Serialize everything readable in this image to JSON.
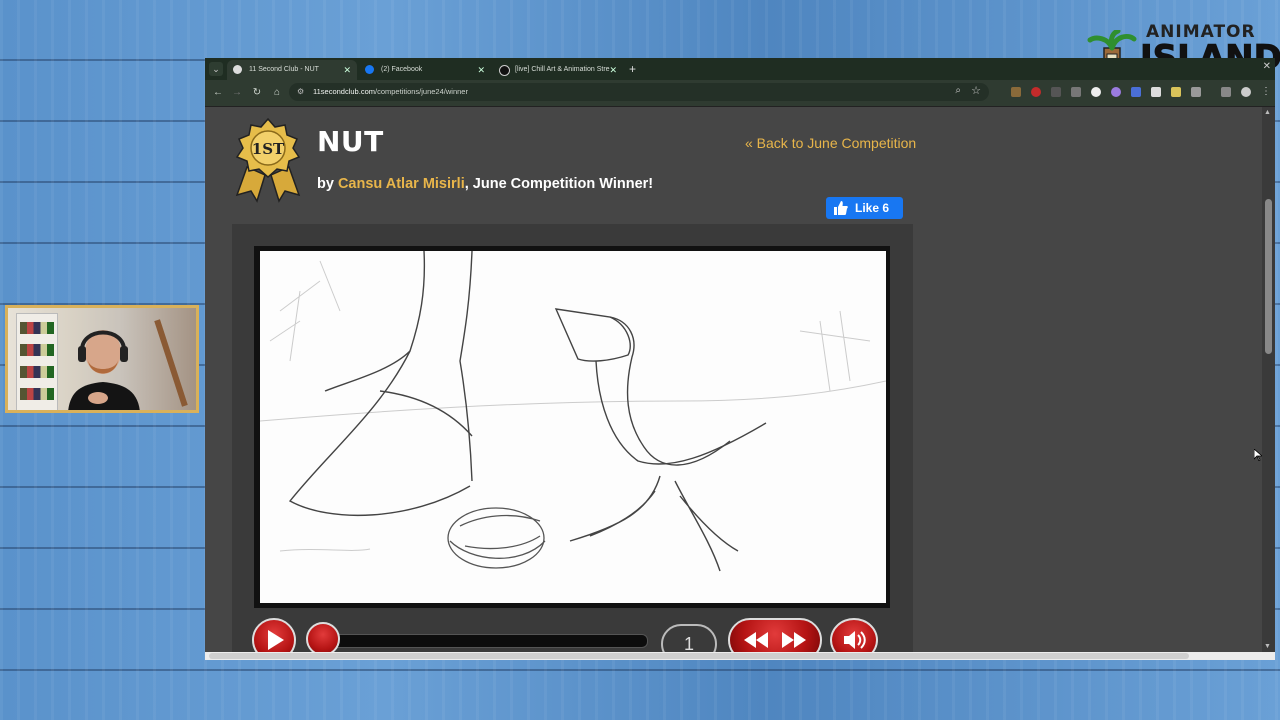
{
  "logo": {
    "line1": "ANIMATOR",
    "line2": "ISLAND"
  },
  "browser": {
    "tabs": [
      {
        "title": "11 Second Club - NUT",
        "active": true
      },
      {
        "title": "(2) Facebook",
        "active": false
      },
      {
        "title": "[live] Chill Art & Animation Stre",
        "active": false
      }
    ],
    "address": {
      "domain": "11secondclub.com",
      "path": "/competitions/june24/winner"
    },
    "colors": {
      "accent": "#e8b54a",
      "like": "#1877f2",
      "player_red": "#b51414"
    }
  },
  "page": {
    "title": "NUT",
    "byline_prefix": "by ",
    "author": "Cansu Atlar Misirli",
    "byline_suffix": ", June Competition Winner!",
    "back_link": "« Back to June Competition",
    "like": {
      "label": "Like",
      "count": "6"
    },
    "medal_text": "1ST",
    "player": {
      "frame_number": "1"
    }
  }
}
